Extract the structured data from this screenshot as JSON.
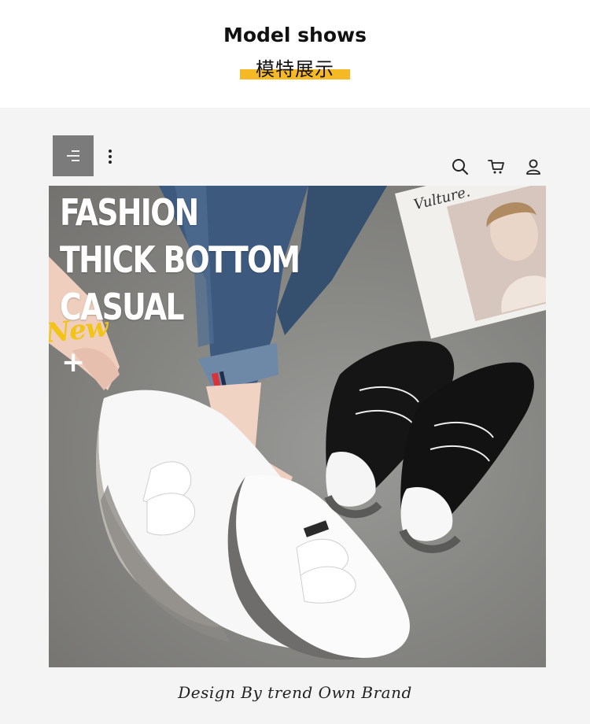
{
  "header": {
    "title_en": "Model shows",
    "title_cn": "模特展示",
    "accent_color": "#f5b926"
  },
  "nav": {
    "menu_icon": "hamburger-menu-icon",
    "more_icon": "vertical-dots-icon",
    "search_icon": "search-icon",
    "cart_icon": "cart-icon",
    "account_icon": "user-icon"
  },
  "hero": {
    "headline": [
      "FASHION",
      "THICK BOTTOM",
      "CASUAL"
    ],
    "badge": "New",
    "plus": "+"
  },
  "footer": {
    "text": "Design By trend Own Brand"
  }
}
